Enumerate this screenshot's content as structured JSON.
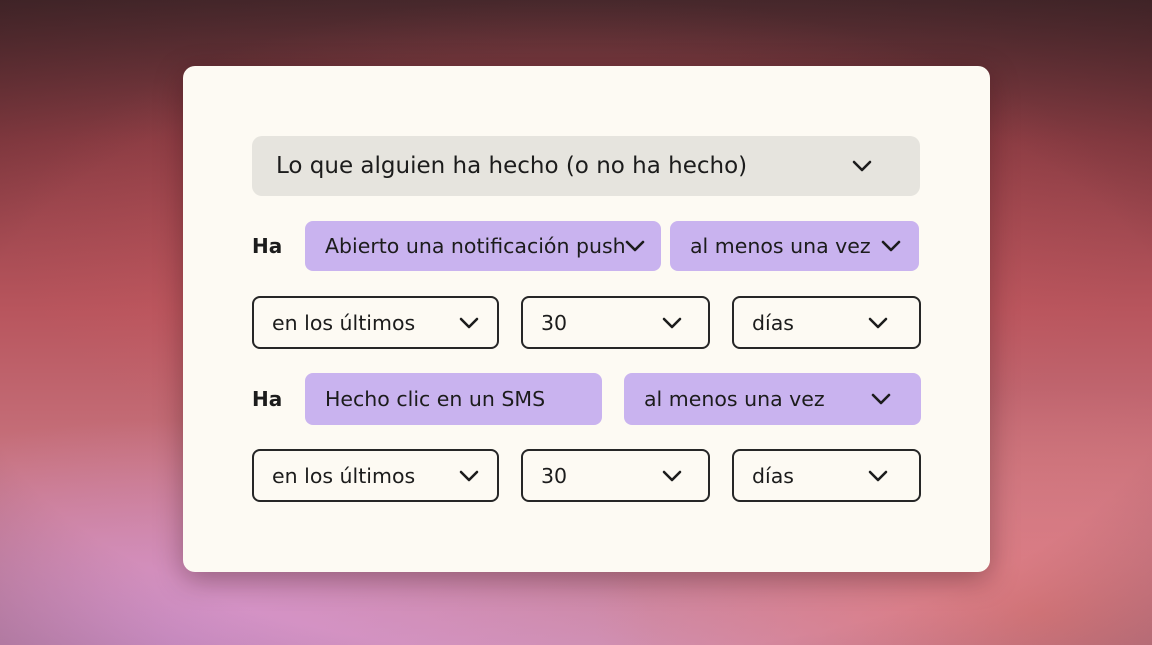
{
  "filter": {
    "main_select": {
      "value": "Lo que alguien ha hecho (o no ha hecho)",
      "icon": "chevron-down-icon"
    },
    "rows": [
      {
        "prefix": "Ha",
        "event": "Abierto una notificación push",
        "frequency": "al menos una vez",
        "window": {
          "qualifier": "en los últimos",
          "amount": "30",
          "unit": "días"
        }
      },
      {
        "prefix": "Ha",
        "event": "Hecho clic en un SMS",
        "frequency": "al menos una vez",
        "window": {
          "qualifier": "en los últimos",
          "amount": "30",
          "unit": "días"
        }
      }
    ]
  },
  "colors": {
    "card_bg": "#fdfaf3",
    "main_select_bg": "#e6e4de",
    "pill_bg": "#c9b3ef",
    "outline_border": "#262626",
    "text": "#1c1c1c"
  }
}
